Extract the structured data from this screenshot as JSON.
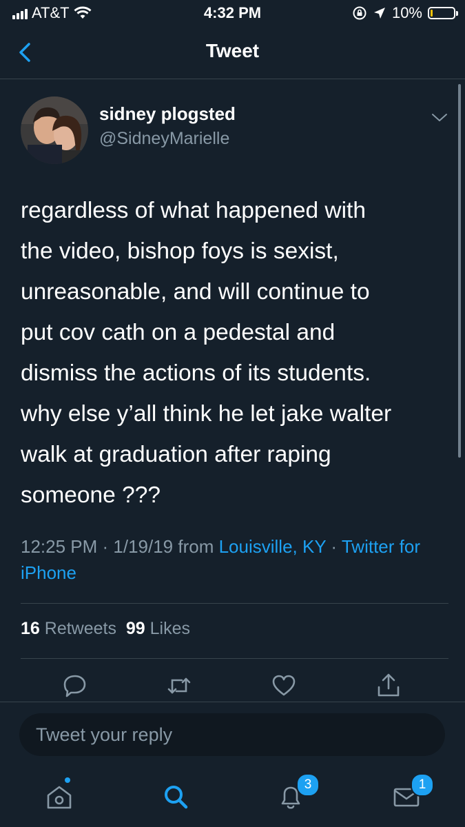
{
  "status_bar": {
    "carrier": "AT&T",
    "time": "4:32 PM",
    "battery_percent_label": "10%",
    "battery_level": 0.1,
    "battery_color": "#f6c20a"
  },
  "nav": {
    "title": "Tweet",
    "back_icon": "chevron-left-icon"
  },
  "tweet": {
    "display_name": "sidney plogsted",
    "handle": "@SidneyMarielle",
    "text": "regardless of what happened with\nthe video, bishop foys is sexist,\nunreasonable, and will continue to\nput cov cath on a pedestal and\ndismiss the actions of its students.\nwhy else y’all think he let jake walter\nwalk at graduation after raping\nsomeone ???",
    "time_date": "12:25 PM · 1/19/19 from ",
    "location": "Louisville, KY",
    "separator": " · ",
    "source": "Twitter for iPhone",
    "retweet_count": "16",
    "retweets_label": "Retweets",
    "like_count": "99",
    "likes_label": "Likes"
  },
  "actions": [
    "reply-icon",
    "retweet-icon",
    "like-icon",
    "share-icon"
  ],
  "reply_box": {
    "placeholder": "Tweet your reply"
  },
  "tab_bar": {
    "items": [
      {
        "icon": "home-icon",
        "has_dot": true
      },
      {
        "icon": "search-icon",
        "active": true
      },
      {
        "icon": "notifications-icon",
        "badge": "3"
      },
      {
        "icon": "messages-icon",
        "badge": "1"
      }
    ]
  },
  "colors": {
    "background": "#15202b",
    "accent": "#1da1f2",
    "secondary_text": "#8899a6",
    "divider": "#38444d"
  }
}
